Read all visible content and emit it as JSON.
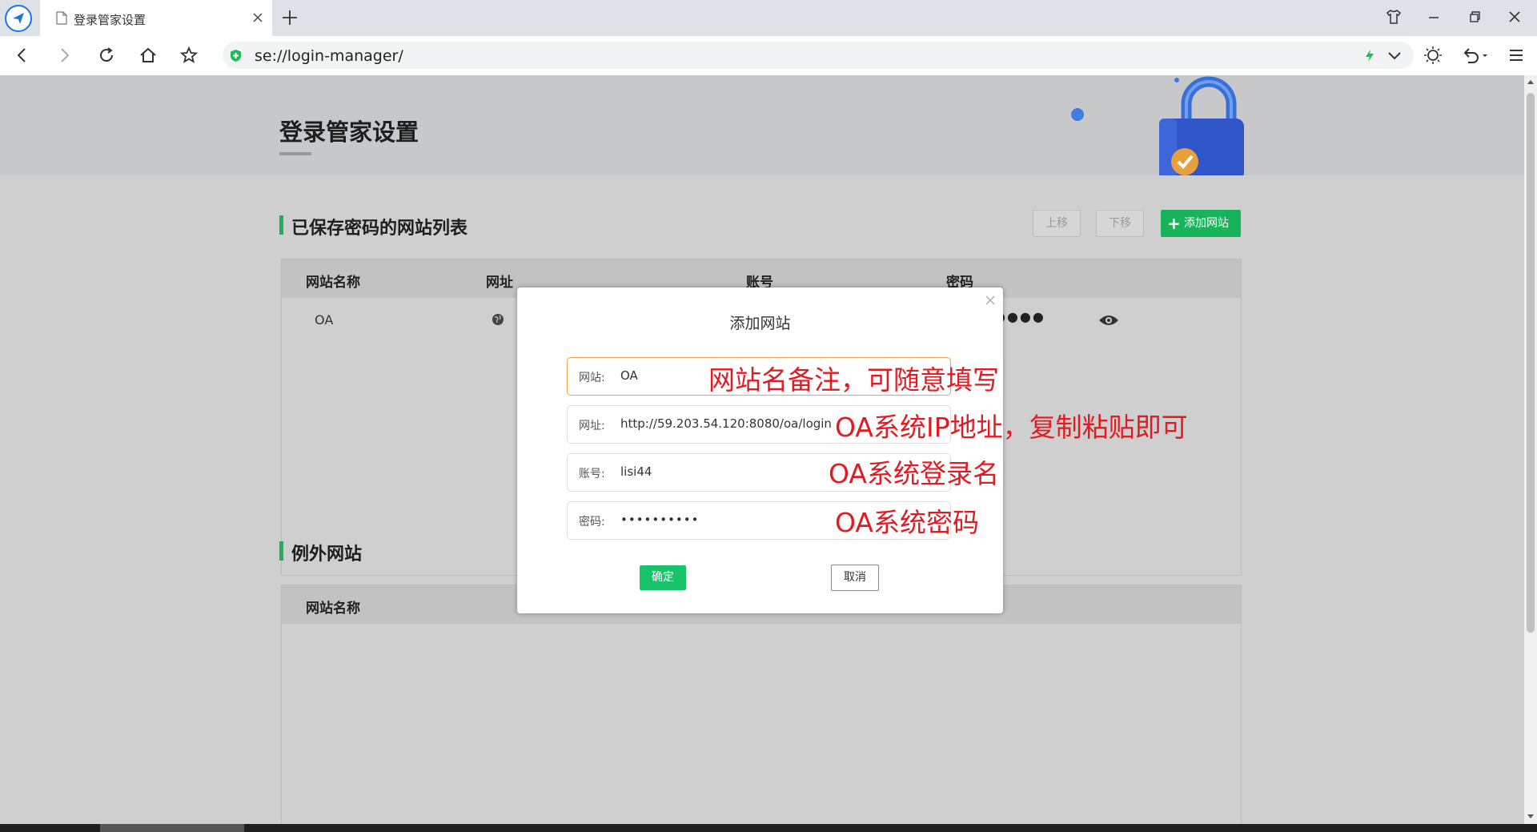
{
  "browser": {
    "tab_title": "登录管家设置",
    "address": "se://login-manager/"
  },
  "banner": {
    "title": "登录管家设置"
  },
  "saved_section": {
    "title": "已保存密码的网站列表",
    "move_up_label": "上移",
    "move_down_label": "下移",
    "add_site_label": "添加网站",
    "columns": [
      "网站名称",
      "网址",
      "账号",
      "密码"
    ],
    "rows": [
      {
        "name": "OA",
        "password_mask": "●●●●"
      }
    ]
  },
  "exception_section": {
    "title": "例外网站",
    "columns": [
      "网站名称"
    ]
  },
  "dialog": {
    "title": "添加网站",
    "fields": [
      {
        "label": "网站:",
        "value": "OA"
      },
      {
        "label": "网址:",
        "value": "http://59.203.54.120:8080/oa/login"
      },
      {
        "label": "账号:",
        "value": "lisi44"
      },
      {
        "label": "密码:",
        "value": "••••••••••"
      }
    ],
    "ok_label": "确定",
    "cancel_label": "取消"
  },
  "annotations": [
    "网站名备注，可随意填写",
    "OA系统IP地址，复制粘贴即可",
    "OA系统登录名",
    "OA系统密码"
  ],
  "colors": {
    "accent_green": "#18b35a",
    "annotation_red": "#e11b22",
    "focus_orange": "#f0a24a"
  }
}
